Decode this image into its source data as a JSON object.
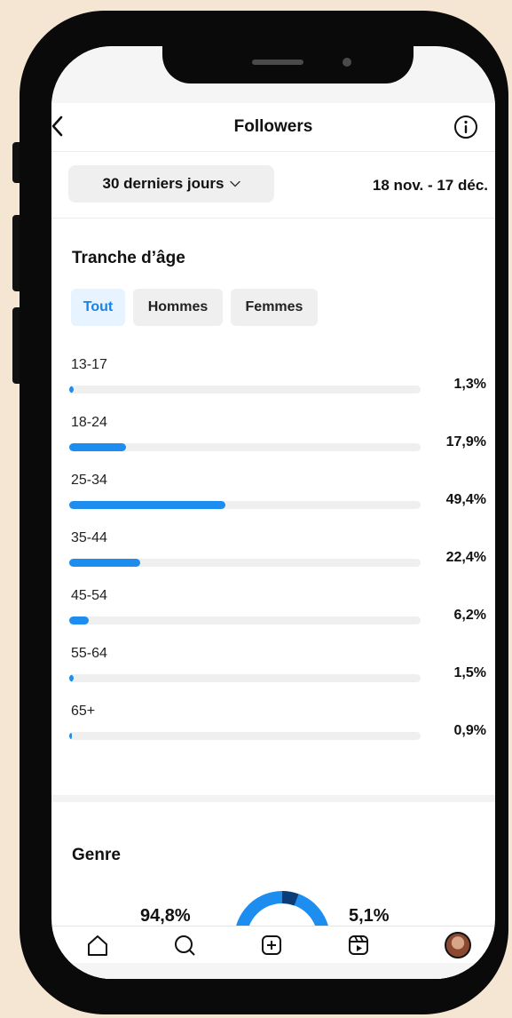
{
  "header": {
    "title": "Followers"
  },
  "period": {
    "selected": "30 derniers jours",
    "range": "18 nov. - 17 déc."
  },
  "age_section": {
    "title": "Tranche d’âge",
    "filters": [
      "Tout",
      "Hommes",
      "Femmes"
    ],
    "active_filter": "Tout",
    "rows": [
      {
        "label": "13-17",
        "value": "1,3%",
        "percent": 1.3
      },
      {
        "label": "18-24",
        "value": "17,9%",
        "percent": 17.9
      },
      {
        "label": "25-34",
        "value": "49,4%",
        "percent": 49.4
      },
      {
        "label": "35-44",
        "value": "22,4%",
        "percent": 22.4
      },
      {
        "label": "45-54",
        "value": "6,2%",
        "percent": 6.2
      },
      {
        "label": "55-64",
        "value": "1,5%",
        "percent": 1.5
      },
      {
        "label": "65+",
        "value": "0,9%",
        "percent": 0.9
      }
    ]
  },
  "gender_section": {
    "title": "Genre",
    "left_value": "94,8%",
    "right_value": "5,1%"
  },
  "nav": {
    "icons": [
      "home-icon",
      "search-icon",
      "create-icon",
      "reels-icon",
      "profile-avatar"
    ]
  },
  "colors": {
    "accent": "#1d8ef0",
    "accent_dark": "#0a3c78",
    "track": "#efefef",
    "bezel": "#0a0a0a",
    "backdrop": "#f5e6d3"
  }
}
